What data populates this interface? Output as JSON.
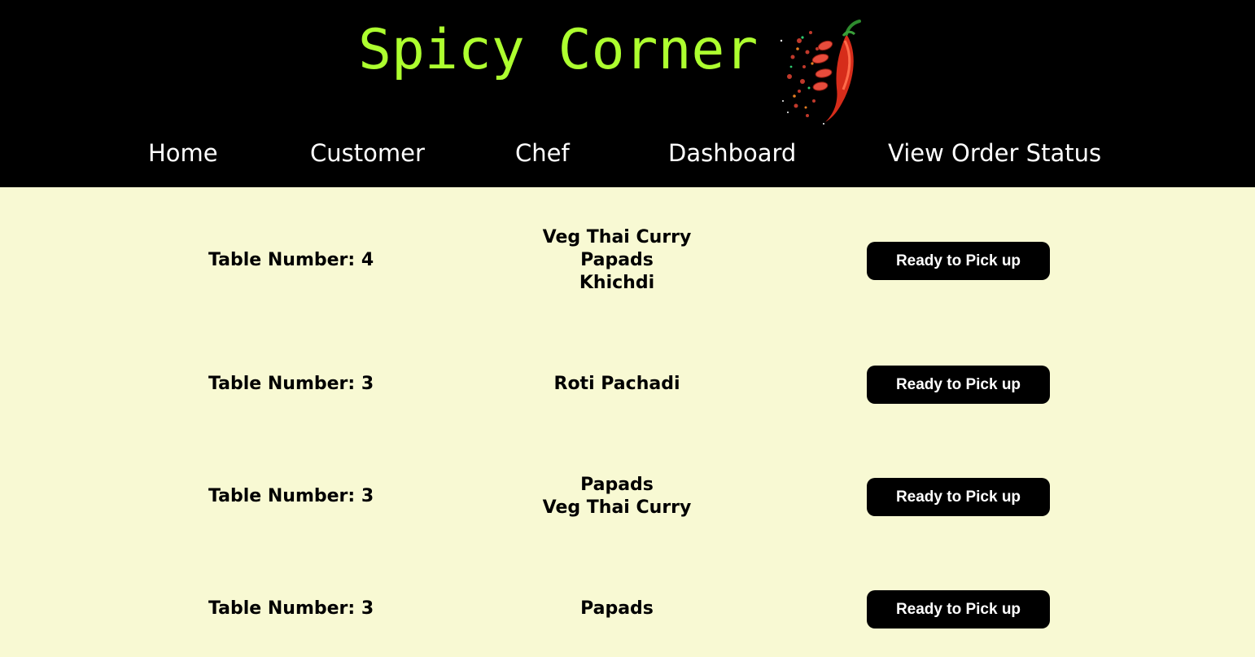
{
  "header": {
    "title": "Spicy Corner",
    "logo_icon": "chili-pepper-icon",
    "title_color": "#adff2f",
    "background": "#000000"
  },
  "nav": {
    "items": [
      {
        "label": "Home"
      },
      {
        "label": "Customer"
      },
      {
        "label": "Chef"
      },
      {
        "label": "Dashboard"
      },
      {
        "label": "View Order Status"
      }
    ]
  },
  "orders": [
    {
      "table_label": "Table Number: 4",
      "items": [
        "Veg Thai Curry",
        "Papads",
        "Khichdi"
      ],
      "button_label": "Ready to Pick up"
    },
    {
      "table_label": "Table Number: 3",
      "items": [
        "Roti Pachadi"
      ],
      "button_label": "Ready to Pick up"
    },
    {
      "table_label": "Table Number: 3",
      "items": [
        "Papads",
        "Veg Thai Curry"
      ],
      "button_label": "Ready to Pick up"
    },
    {
      "table_label": "Table Number: 3",
      "items": [
        "Papads"
      ],
      "button_label": "Ready to Pick up"
    }
  ],
  "colors": {
    "page_background": "#f8f9d3",
    "button_background": "#000000",
    "button_text": "#ffffff"
  }
}
